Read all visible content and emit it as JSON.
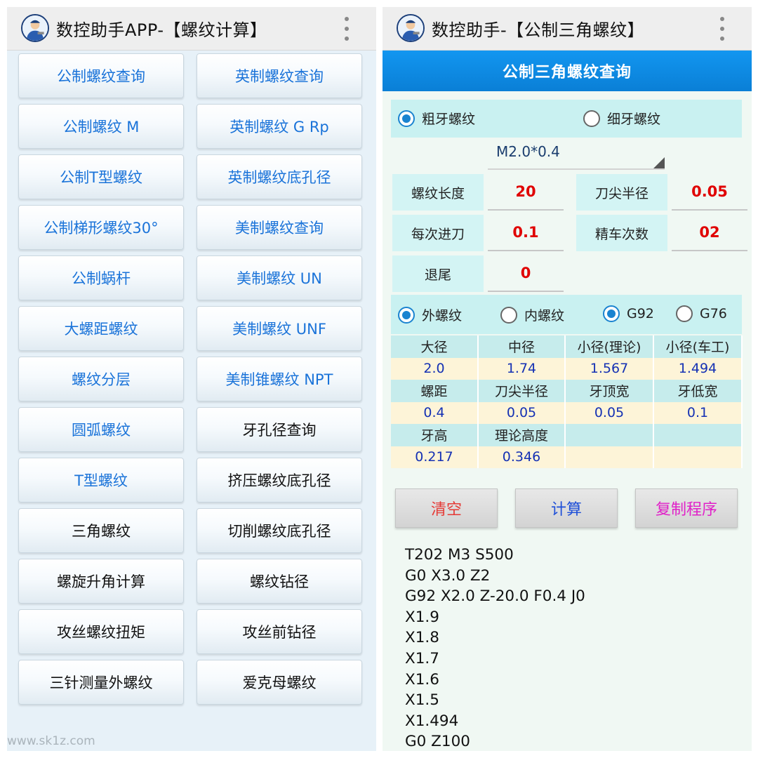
{
  "left": {
    "title": "数控助手APP-【螺纹计算】",
    "logo_icon": "machinist-logo-icon",
    "menu_icon": "overflow-menu-icon",
    "buttons": [
      {
        "label": "公制螺纹查询",
        "style": "blue"
      },
      {
        "label": "英制螺纹查询",
        "style": "blue"
      },
      {
        "label": "公制螺纹 M",
        "style": "blue"
      },
      {
        "label": "英制螺纹 G Rp",
        "style": "blue"
      },
      {
        "label": "公制T型螺纹",
        "style": "blue"
      },
      {
        "label": "英制螺纹底孔径",
        "style": "blue"
      },
      {
        "label": "公制梯形螺纹30°",
        "style": "blue"
      },
      {
        "label": "美制螺纹查询",
        "style": "blue"
      },
      {
        "label": "公制蜗杆",
        "style": "blue"
      },
      {
        "label": "美制螺纹 UN",
        "style": "blue"
      },
      {
        "label": "大螺距螺纹",
        "style": "blue"
      },
      {
        "label": "美制螺纹 UNF",
        "style": "blue"
      },
      {
        "label": "螺纹分层",
        "style": "blue"
      },
      {
        "label": "美制锥螺纹 NPT",
        "style": "blue"
      },
      {
        "label": "圆弧螺纹",
        "style": "blue"
      },
      {
        "label": "牙孔径查询",
        "style": "dark"
      },
      {
        "label": "T型螺纹",
        "style": "blue"
      },
      {
        "label": "挤压螺纹底孔径",
        "style": "dark"
      },
      {
        "label": "三角螺纹",
        "style": "dark"
      },
      {
        "label": "切削螺纹底孔径",
        "style": "dark"
      },
      {
        "label": "螺旋升角计算",
        "style": "dark"
      },
      {
        "label": "螺纹钻径",
        "style": "dark"
      },
      {
        "label": "攻丝螺纹扭矩",
        "style": "dark"
      },
      {
        "label": "攻丝前钻径",
        "style": "dark"
      },
      {
        "label": "三针测量外螺纹",
        "style": "dark"
      },
      {
        "label": "爱克母螺纹",
        "style": "dark"
      }
    ],
    "watermark": "www.sk1z.com"
  },
  "right": {
    "title": "数控助手-【公制三角螺纹】",
    "section_title": "公制三角螺纹查询",
    "thread_type": {
      "coarse": "粗牙螺纹",
      "fine": "细牙螺纹",
      "selected": "coarse"
    },
    "spec_select": "M2.0*0.4",
    "params": {
      "thread_length": {
        "label": "螺纹长度",
        "value": "20"
      },
      "tip_radius": {
        "label": "刀尖半径",
        "value": "0.05"
      },
      "feed_per_pass": {
        "label": "每次进刀",
        "value": "0.1"
      },
      "finish_passes": {
        "label": "精车次数",
        "value": "02"
      },
      "runout": {
        "label": "退尾",
        "value": "0"
      }
    },
    "mode": {
      "external": "外螺纹",
      "internal": "内螺纹",
      "g92": "G92",
      "g76": "G76",
      "selected_side": "external",
      "selected_cycle": "g92"
    },
    "results": {
      "row1_head": [
        "大径",
        "中径",
        "小径(理论)",
        "小径(车工)"
      ],
      "row1_val": [
        "2.0",
        "1.74",
        "1.567",
        "1.494"
      ],
      "row2_head": [
        "螺距",
        "刀尖半径",
        "牙顶宽",
        "牙低宽"
      ],
      "row2_val": [
        "0.4",
        "0.05",
        "0.05",
        "0.1"
      ],
      "row3_head": [
        "牙高",
        "理论高度",
        "",
        ""
      ],
      "row3_val": [
        "0.217",
        "0.346",
        "",
        ""
      ]
    },
    "actions": {
      "clear": "清空",
      "calculate": "计算",
      "copy": "复制程序",
      "colors": {
        "clear": "#e53935",
        "calculate": "#1e4fd8",
        "copy": "#e020c8"
      }
    },
    "program_lines": [
      "T202 M3 S500",
      "G0 X3.0 Z2",
      "G92 X2.0 Z-20.0 F0.4 J0",
      "X1.9",
      "X1.8",
      "X1.7",
      "X1.6",
      "X1.5",
      "X1.494",
      "G0 Z100"
    ]
  },
  "colors": {
    "accent_blue": "#0a7fd6",
    "param_value_red": "#e00000",
    "result_value_blue": "#1531b4",
    "link_blue": "#1a73d9"
  }
}
